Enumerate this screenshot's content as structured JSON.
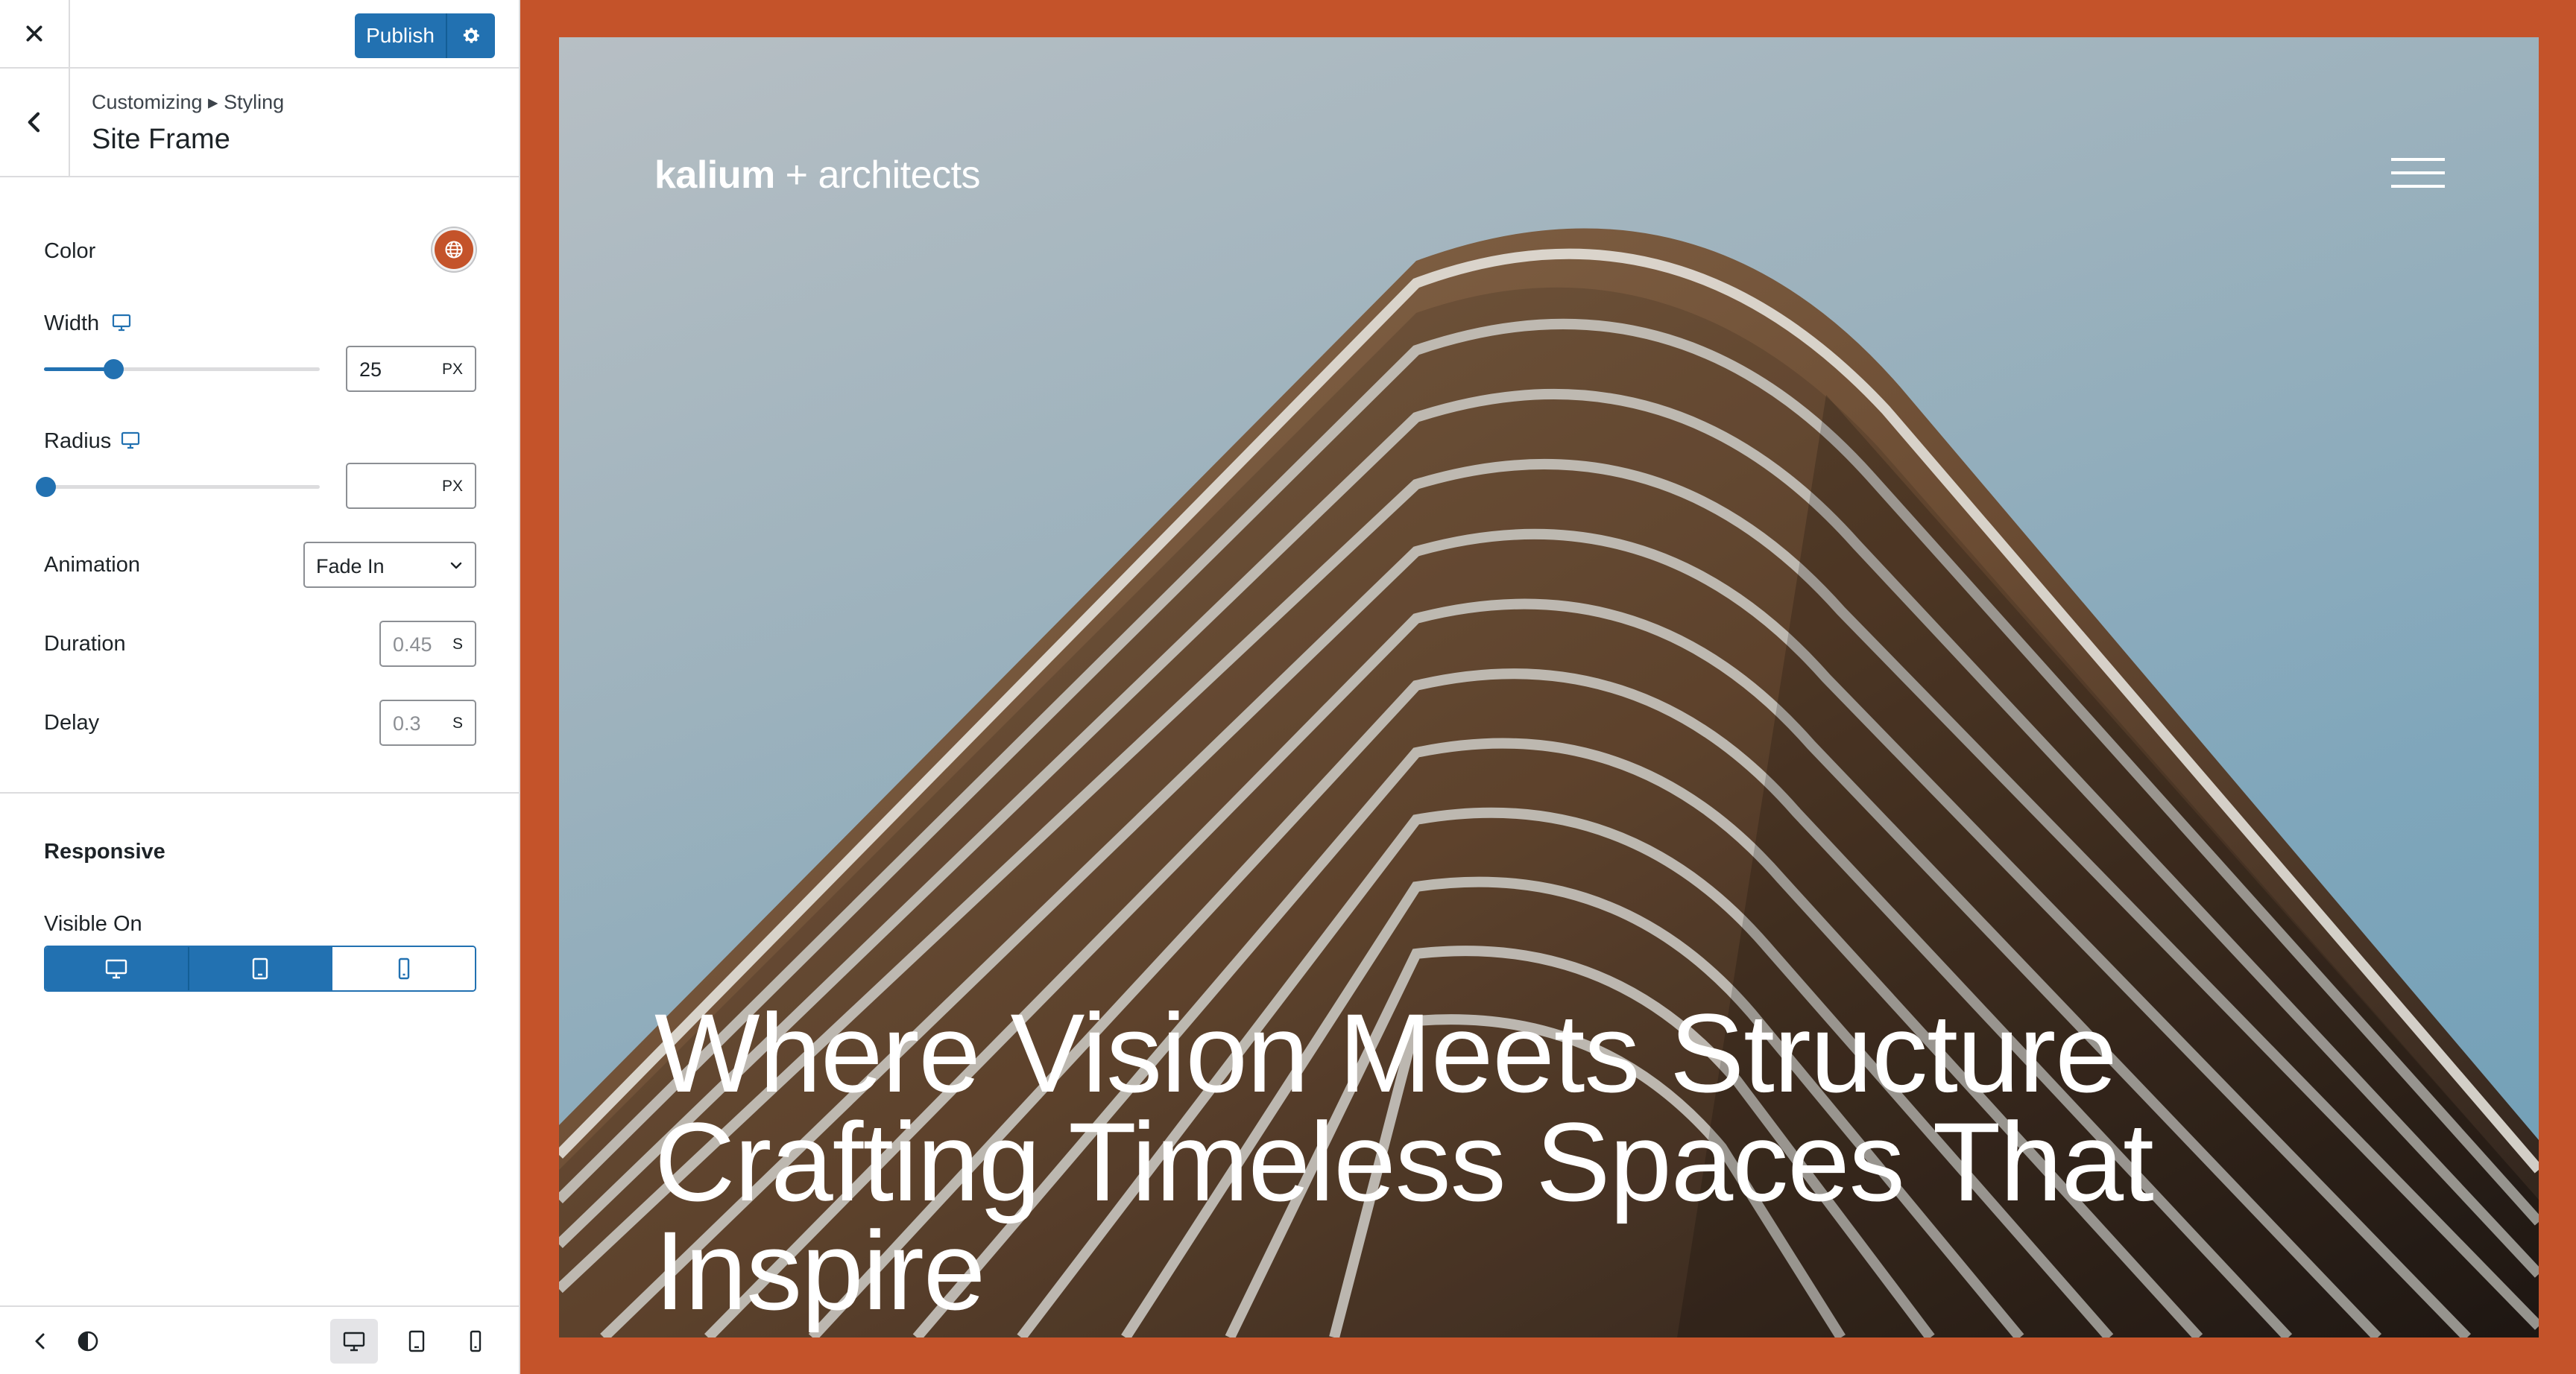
{
  "topbar": {
    "publish_label": "Publish"
  },
  "section": {
    "breadcrumb": "Customizing ▸ Styling",
    "title": "Site Frame"
  },
  "controls": {
    "color_label": "Color",
    "color_value": "#c4532a",
    "width_label": "Width",
    "width_value": "25",
    "width_unit": "PX",
    "width_fraction": 0.15,
    "radius_label": "Radius",
    "radius_value": "",
    "radius_unit": "PX",
    "radius_fraction": 0,
    "animation_label": "Animation",
    "animation_value": "Fade In",
    "duration_label": "Duration",
    "duration_placeholder": "0.45",
    "duration_unit": "S",
    "delay_label": "Delay",
    "delay_placeholder": "0.3",
    "delay_unit": "S"
  },
  "responsive": {
    "heading": "Responsive",
    "visible_on_label": "Visible On",
    "devices": [
      {
        "icon": "desktop-icon",
        "active": true
      },
      {
        "icon": "tablet-icon",
        "active": true
      },
      {
        "icon": "mobile-icon",
        "active": false
      }
    ]
  },
  "footer": {
    "icons": [
      "collapse-arrow-icon",
      "contrast-icon",
      "desktop-icon",
      "tablet-icon",
      "mobile-icon"
    ]
  },
  "preview": {
    "frame_color": "#c4532a",
    "logo_bold": "kalium",
    "logo_rest": " + architects",
    "headline_lines": [
      "Where Vision Meets Structure",
      "Crafting Timeless Spaces That",
      "Inspire"
    ]
  },
  "colors": {
    "accent": "#2271b1",
    "frame": "#c4532a"
  }
}
